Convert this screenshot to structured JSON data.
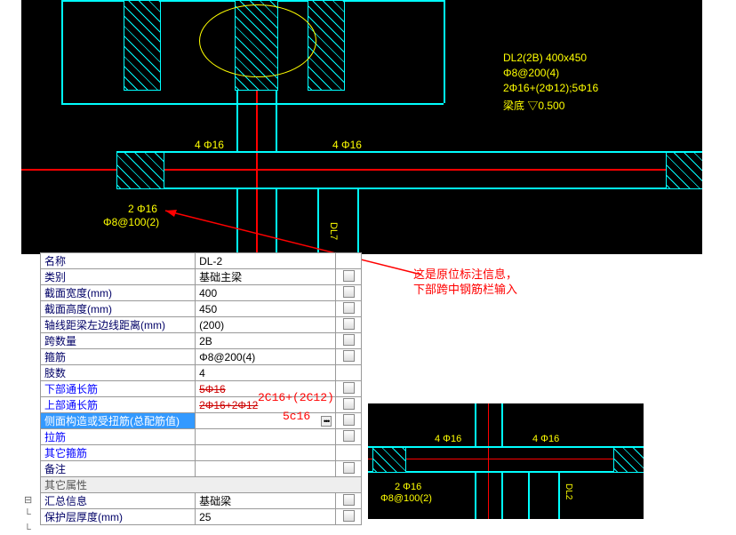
{
  "cad": {
    "ann1": "DL2(2B) 400x450",
    "ann2": "Φ8@200(4)",
    "ann3": "2Φ16+(2Φ12);5Φ16",
    "ann4": "梁底 ▽0.500",
    "top1": "4 Φ16",
    "top2": "4 Φ16",
    "bot1": "2 Φ16",
    "bot2": "Φ8@100(2)",
    "side": "DL7"
  },
  "note": {
    "l1": "这是原位标注信息，",
    "l2": "下部跨中钢筋栏输入"
  },
  "mini": {
    "t1": "4 Φ16",
    "t2": "4 Φ16",
    "b1": "2 Φ16",
    "b2": "Φ8@100(2)",
    "side": "DL2"
  },
  "prop": {
    "name": {
      "k": "名称",
      "v": "DL-2"
    },
    "cat": {
      "k": "类别",
      "v": "基础主梁"
    },
    "w": {
      "k": "截面宽度(mm)",
      "v": "400"
    },
    "h": {
      "k": "截面高度(mm)",
      "v": "450"
    },
    "off": {
      "k": "轴线距梁左边线距离(mm)",
      "v": "(200)"
    },
    "span": {
      "k": "跨数量",
      "v": "2B"
    },
    "stir": {
      "k": "箍筋",
      "v": "Φ8@200(4)"
    },
    "leg": {
      "k": "肢数",
      "v": "4"
    },
    "bot": {
      "k": "下部通长筋",
      "v": "5Φ16",
      "red": "2C16+(2C12)"
    },
    "top": {
      "k": "上部通长筋",
      "v": "2Φ16+2Φ12",
      "red": "5c16"
    },
    "side": {
      "k": "侧面构造或受扭筋(总配筋值)",
      "v": ""
    },
    "tie": {
      "k": "拉筋",
      "v": ""
    },
    "ostir": {
      "k": "其它箍筋",
      "v": ""
    },
    "memo": {
      "k": "备注",
      "v": ""
    },
    "grp": {
      "k": "其它属性"
    },
    "sum": {
      "k": "汇总信息",
      "v": "基础梁"
    },
    "cov": {
      "k": "保护层厚度(mm)",
      "v": "25"
    }
  }
}
